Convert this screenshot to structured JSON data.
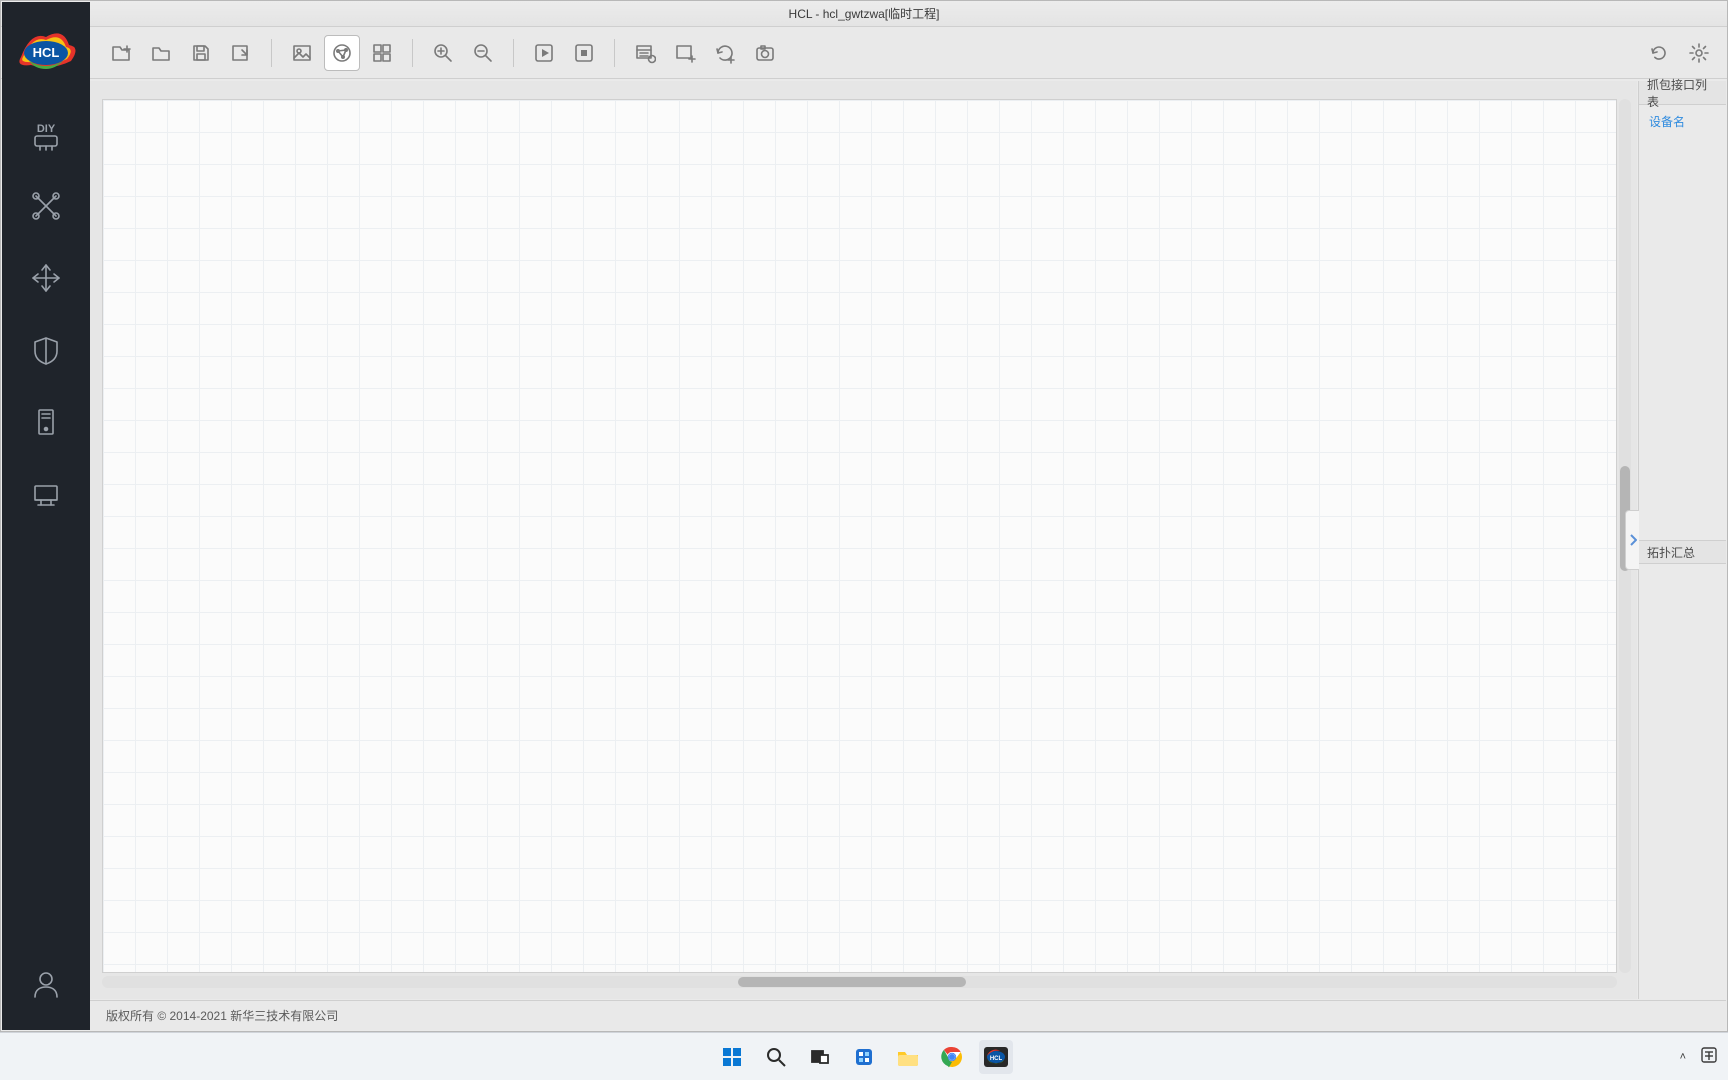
{
  "title_bar": {
    "text": "HCL - hcl_gwtzwa[临时工程]"
  },
  "sidebar": {
    "items": [
      {
        "name": "diy",
        "label": "DIY"
      },
      {
        "name": "topology",
        "label": ""
      },
      {
        "name": "move",
        "label": ""
      },
      {
        "name": "firewall",
        "label": ""
      },
      {
        "name": "server",
        "label": ""
      },
      {
        "name": "host",
        "label": ""
      }
    ]
  },
  "toolbar": {
    "group1": [
      "new-project",
      "open-project",
      "save-project",
      "export"
    ],
    "group2": [
      "insert-image",
      "topology-map",
      "grid-layout"
    ],
    "group3": [
      "zoom-in",
      "zoom-out"
    ],
    "group4": [
      "play",
      "stop"
    ],
    "group5": [
      "add-window",
      "add-panel",
      "add-cycle",
      "screenshot"
    ],
    "right": [
      "refresh",
      "settings"
    ]
  },
  "right_panel": {
    "section1_title": "抓包接口列表",
    "section1_link": "设备名",
    "section2_title": "拓扑汇总"
  },
  "footer": {
    "copyright": "版权所有 © 2014-2021 新华三技术有限公司"
  },
  "taskbar": {
    "apps": [
      "start",
      "search",
      "taskview",
      "widgets",
      "explorer",
      "chrome",
      "hcl"
    ],
    "tray": {
      "expand": "˄",
      "ime": "中"
    }
  },
  "colors": {
    "sidebar_bg": "#1f242b",
    "accent_link": "#2f8bdf"
  }
}
